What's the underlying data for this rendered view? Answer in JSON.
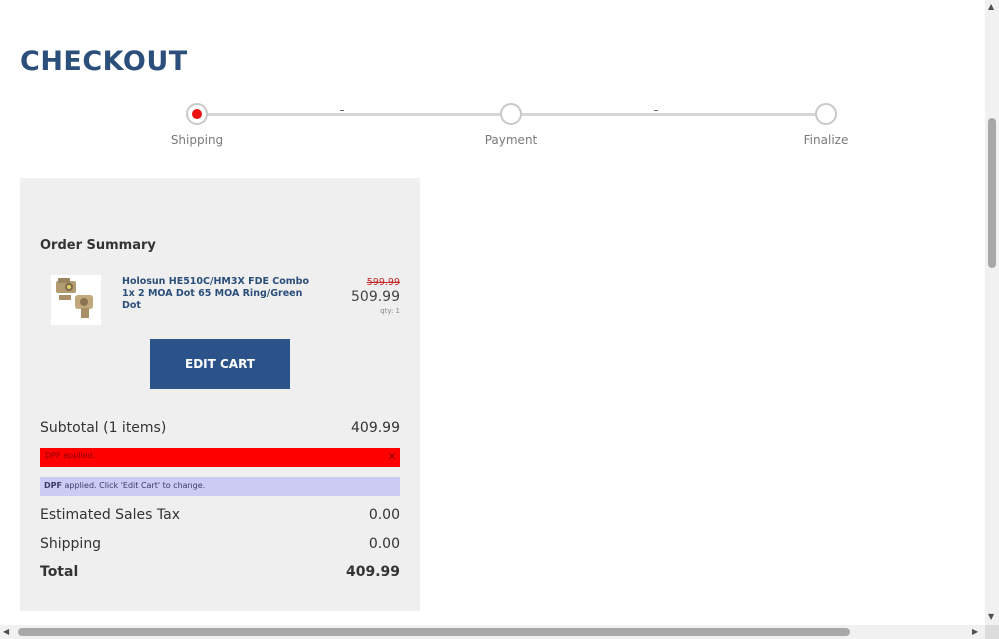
{
  "page": {
    "title": "CHECKOUT"
  },
  "stepper": {
    "steps": [
      {
        "label": "Shipping",
        "active": true
      },
      {
        "label": "Payment",
        "active": false
      },
      {
        "label": "Finalize",
        "active": false
      }
    ]
  },
  "summary": {
    "title": "Order Summary",
    "item": {
      "name": "Holosun HE510C/HM3X FDE Combo 1x 2 MOA Dot 65 MOA Ring/Green Dot",
      "old_price": "599.99",
      "price": "509.99",
      "qty": "qty: 1"
    },
    "edit_cart_label": "EDIT CART",
    "subtotal_label": "Subtotal (1 items)",
    "subtotal_value": "409.99",
    "alert_red_msg": "DPF applied.",
    "alert_red_close": "×",
    "alert_blue_code": "DPF",
    "alert_blue_msg": " applied. Click 'Edit Cart' to change.",
    "tax_label": "Estimated Sales Tax",
    "tax_value": "0.00",
    "shipping_label": "Shipping",
    "shipping_value": "0.00",
    "total_label": "Total",
    "total_value": "409.99"
  },
  "colors": {
    "accent": "#2b4f7a",
    "button": "#2b5289",
    "active_step": "#ee1111",
    "alert_red": "#ff0000",
    "alert_blue": "#cbcbf3"
  },
  "scrollbars": {
    "up_arrow": "▲",
    "down_arrow": "▼",
    "left_arrow": "◀",
    "right_arrow": "▶"
  }
}
